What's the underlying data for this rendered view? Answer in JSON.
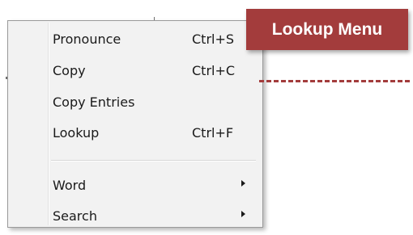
{
  "menu": {
    "items": [
      {
        "label": "Pronounce",
        "shortcut": "Ctrl+S"
      },
      {
        "label": "Copy",
        "shortcut": "Ctrl+C"
      },
      {
        "label": "Copy Entries",
        "shortcut": ""
      },
      {
        "label": "Lookup",
        "shortcut": "Ctrl+F"
      },
      {
        "label": "Word",
        "submenu": true
      },
      {
        "label": "Search",
        "submenu": true
      }
    ]
  },
  "callout": {
    "label": "Lookup Menu",
    "color": "#a33c3c"
  },
  "icons": {
    "submenu_arrow": "chevron-right-icon"
  }
}
